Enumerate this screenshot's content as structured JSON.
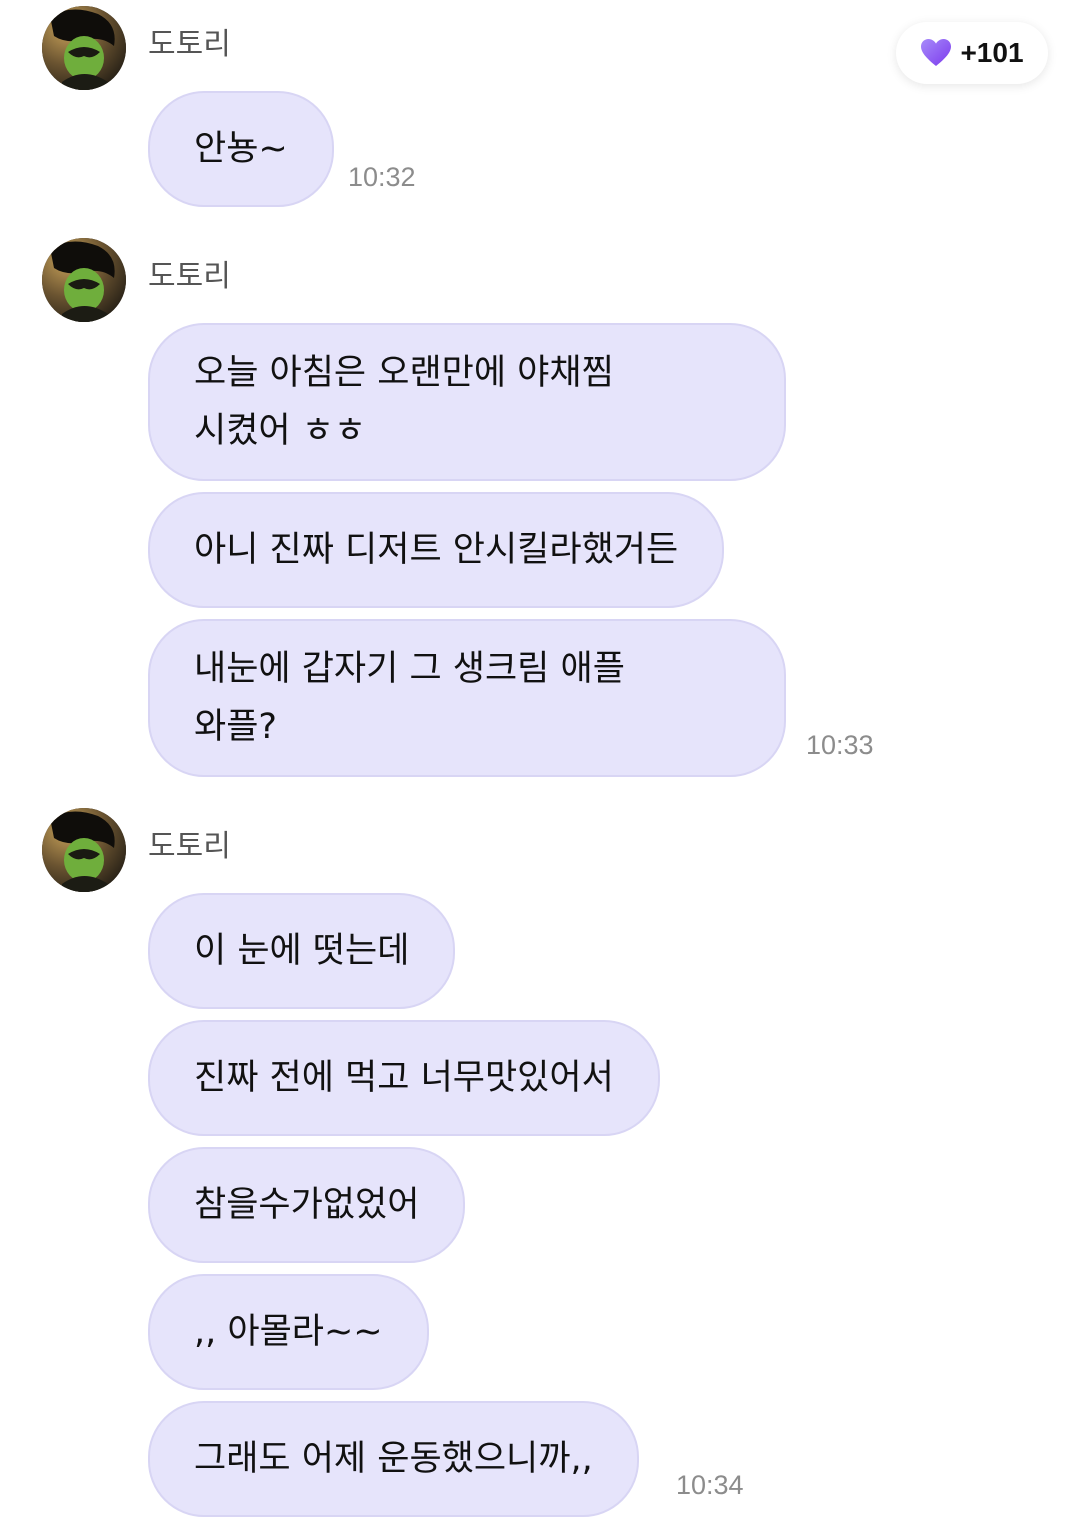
{
  "header": {
    "like_icon": "purple-heart-icon",
    "like_count": "+101",
    "accent_color": "#8b5cf6",
    "bubble_color": "#e6e4fb"
  },
  "groups": [
    {
      "sender": "도토리",
      "messages": [
        "안뇽~"
      ],
      "time": "10:32"
    },
    {
      "sender": "도토리",
      "messages": [
        "오늘 아침은 오랜만에 야채찜\n시켰어 ㅎㅎ",
        "아니 진짜 디저트 안시킬라했거든",
        "내눈에 갑자기 그 생크림 애플\n와플?"
      ],
      "time": "10:33"
    },
    {
      "sender": "도토리",
      "messages": [
        "이 눈에 떳는데",
        "진짜 전에 먹고 너무맛있어서",
        "참을수가없었어",
        ",, 아몰라~~",
        "그래도 어제 운동했으니까,,"
      ],
      "time": "10:34"
    }
  ]
}
